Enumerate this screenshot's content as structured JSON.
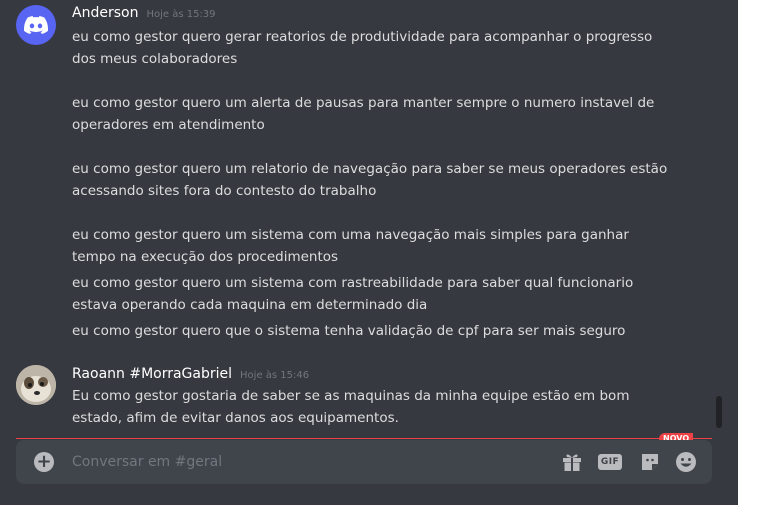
{
  "messages": [
    {
      "author": "Anderson",
      "timestamp": "Hoje às 15:39",
      "avatar": "discord-logo-icon",
      "lines": [
        "eu como gestor quero gerar reatorios de produtividade para acompanhar o progresso",
        "dos meus colaboradores",
        "eu como gestor quero um alerta de pausas para manter sempre o numero instavel de",
        "operadores em atendimento",
        "eu como gestor quero um relatorio de navegação para saber se meus operadores estão",
        "acessando sites fora do contesto do trabalho",
        "eu como gestor quero um sistema com uma navegação mais simples para ganhar",
        "tempo na execução dos procedimentos",
        "eu como gestor quero um sistema com rastreabilidade para saber qual funcionario",
        "estava operando cada maquina em determinado dia",
        "eu como gestor quero que o sistema tenha validação de cpf para ser mais seguro"
      ]
    },
    {
      "author": "Raoann #MorraGabriel",
      "timestamp": "Hoje às 15:46",
      "avatar": "user-photo-avatar",
      "lines": [
        "Eu como gestor gostaria de saber se as maquinas da minha equipe estão em bom",
        "estado, afim de evitar danos aos equipamentos."
      ]
    }
  ],
  "divider": {
    "badge": "NOVO"
  },
  "composer": {
    "placeholder": "Conversar em #geral",
    "gif_label": "GIF",
    "icons": [
      "plus-circle-icon",
      "gift-icon",
      "gif-icon",
      "sticker-icon",
      "emoji-icon"
    ]
  },
  "colors": {
    "background": "#36393f",
    "composer": "#40444b",
    "text": "#dcddde",
    "muted": "#72767d",
    "accent_red": "#ed4245",
    "blurple": "#5865f2"
  }
}
